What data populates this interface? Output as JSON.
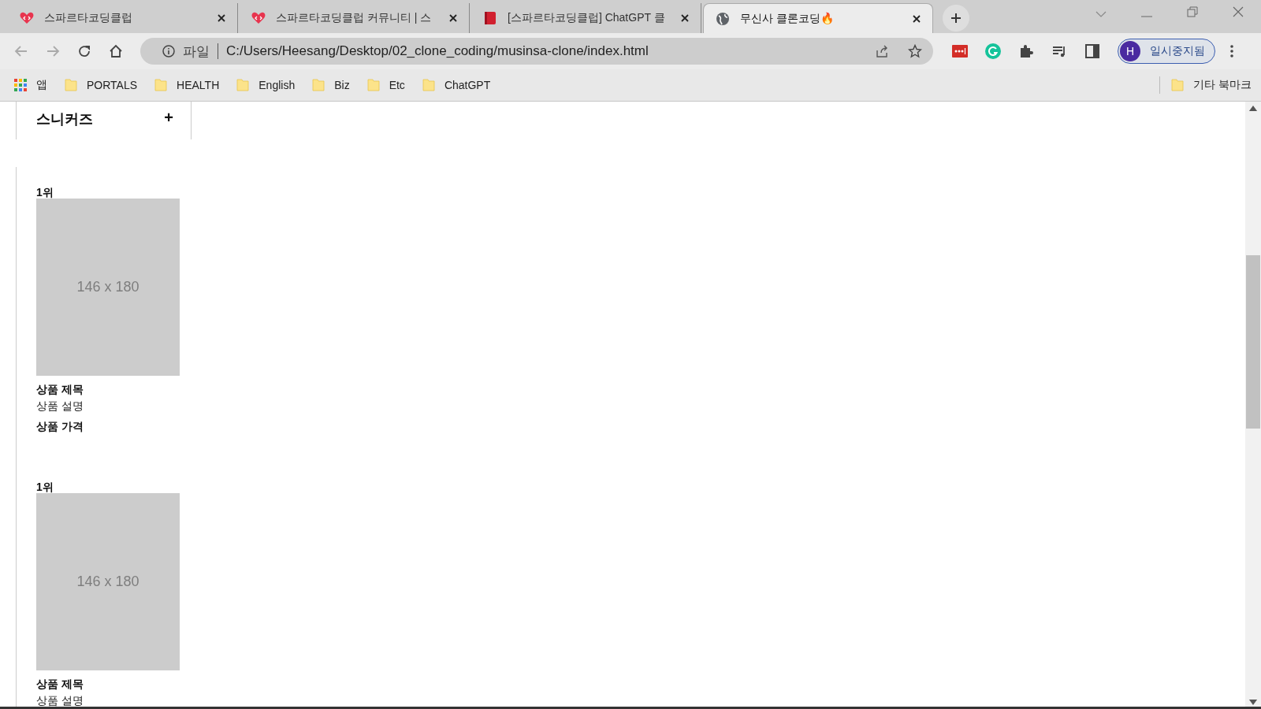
{
  "browser": {
    "tabs": [
      {
        "title": "스파르타코딩클럽",
        "kind": "heart",
        "selected": false
      },
      {
        "title": "스파르타코딩클럽 커뮤니티 | 스",
        "kind": "heart",
        "selected": false
      },
      {
        "title": "[스파르타코딩클럽] ChatGPT 클",
        "kind": "book",
        "selected": false
      },
      {
        "title": "무신사 클론코딩🔥",
        "kind": "globe",
        "selected": true
      }
    ],
    "address": {
      "scheme": "파일",
      "url": "C:/Users/Heesang/Desktop/02_clone_coding/musinsa-clone/index.html"
    },
    "profile": {
      "initial": "H",
      "status": "일시중지됨"
    },
    "bookmarks": [
      {
        "label": "앱",
        "kind": "apps"
      },
      {
        "label": "PORTALS",
        "kind": "folder"
      },
      {
        "label": "HEALTH",
        "kind": "folder"
      },
      {
        "label": "English",
        "kind": "folder"
      },
      {
        "label": "Biz",
        "kind": "folder"
      },
      {
        "label": "Etc",
        "kind": "folder"
      },
      {
        "label": "ChatGPT",
        "kind": "folder"
      }
    ],
    "other_bookmarks": "기타 북마크"
  },
  "page": {
    "category": {
      "title": "스니커즈",
      "toggle": "+"
    },
    "products": [
      {
        "rank": "1위",
        "image_label": "146 x 180",
        "title": "상품 제목",
        "description": "상품 설명",
        "price": "상품 가격"
      },
      {
        "rank": "1위",
        "image_label": "146 x 180",
        "title": "상품 제목",
        "description": "상품 설명"
      }
    ]
  }
}
